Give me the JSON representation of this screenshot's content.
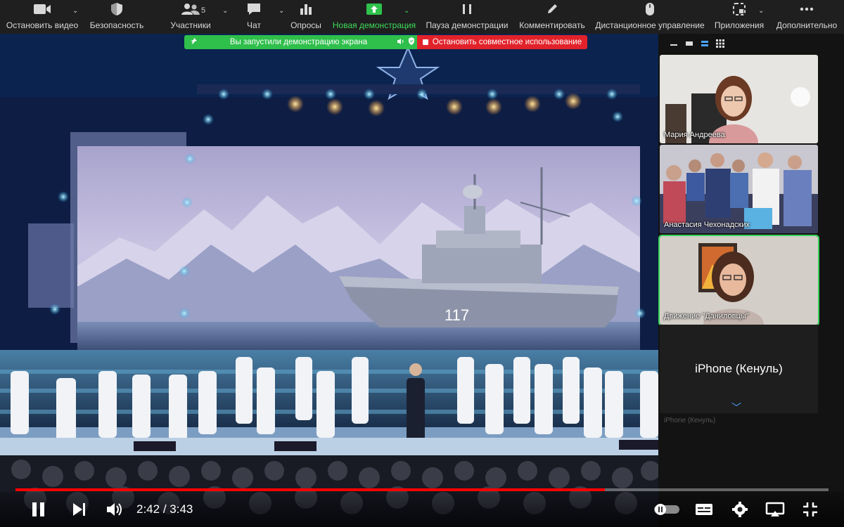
{
  "toolbar": {
    "items": [
      {
        "label": "Остановить видео",
        "icon": "video-camera-icon"
      },
      {
        "label": "Безопасность",
        "icon": "shield-icon"
      },
      {
        "label": "Участники",
        "icon": "participants-icon",
        "count": "5"
      },
      {
        "label": "Чат",
        "icon": "chat-icon"
      },
      {
        "label": "Опросы",
        "icon": "polls-icon"
      },
      {
        "label": "Новая демонстрация",
        "icon": "share-screen-icon"
      },
      {
        "label": "Пауза демонстрации",
        "icon": "pause-icon"
      },
      {
        "label": "Комментировать",
        "icon": "pencil-icon"
      },
      {
        "label": "Дистанционное управление",
        "icon": "mouse-icon"
      },
      {
        "label": "Приложения",
        "icon": "apps-icon"
      },
      {
        "label": "Дополнительно",
        "icon": "more-icon"
      }
    ],
    "accent_green": "#3ddc5a"
  },
  "banner": {
    "sharing_text": "Вы запустили демонстрацию экрана",
    "stop_text": "Остановить совместное использование"
  },
  "participants": [
    {
      "name": "Мария Андреева"
    },
    {
      "name": "Анастасия Чехонадских"
    },
    {
      "name": "Движение \"Даниловцы\"",
      "active": true
    },
    {
      "name": "iPhone (Кенуль)",
      "camera_off": true
    }
  ],
  "player": {
    "current_time": "2:42",
    "separator": "/",
    "duration": "3:43",
    "progress": 0.725,
    "progress_color": "#ff0000"
  },
  "video": {
    "ship_hull_number": "117"
  }
}
